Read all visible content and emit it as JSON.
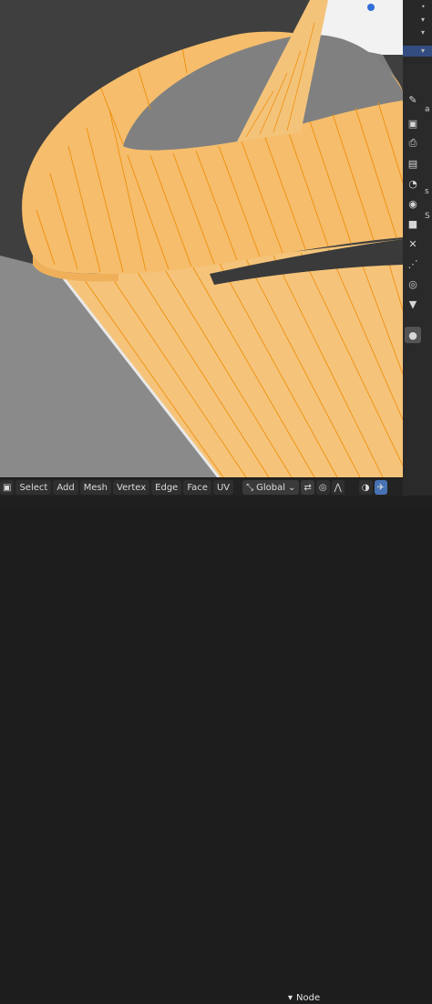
{
  "toolbar": {
    "menu_select": "Select",
    "menu_add": "Add",
    "menu_mesh": "Mesh",
    "menu_vertex": "Vertex",
    "menu_edge": "Edge",
    "menu_face": "Face",
    "menu_uv": "UV",
    "transform_orientation": "Global",
    "icons": [
      "orientation-icon",
      "snap-icon",
      "proportional-icon",
      "overlay-icon",
      "xray-icon"
    ]
  },
  "node_panel": {
    "title": "Node"
  },
  "properties": {
    "letters": [
      "a",
      "s",
      "S"
    ]
  },
  "colors": {
    "mesh_face": "#f5b963",
    "mesh_edge": "#f08a00",
    "inner_wall": "#8c8c8c",
    "background": "#3d3d3d",
    "selected_row": "#334d80"
  }
}
